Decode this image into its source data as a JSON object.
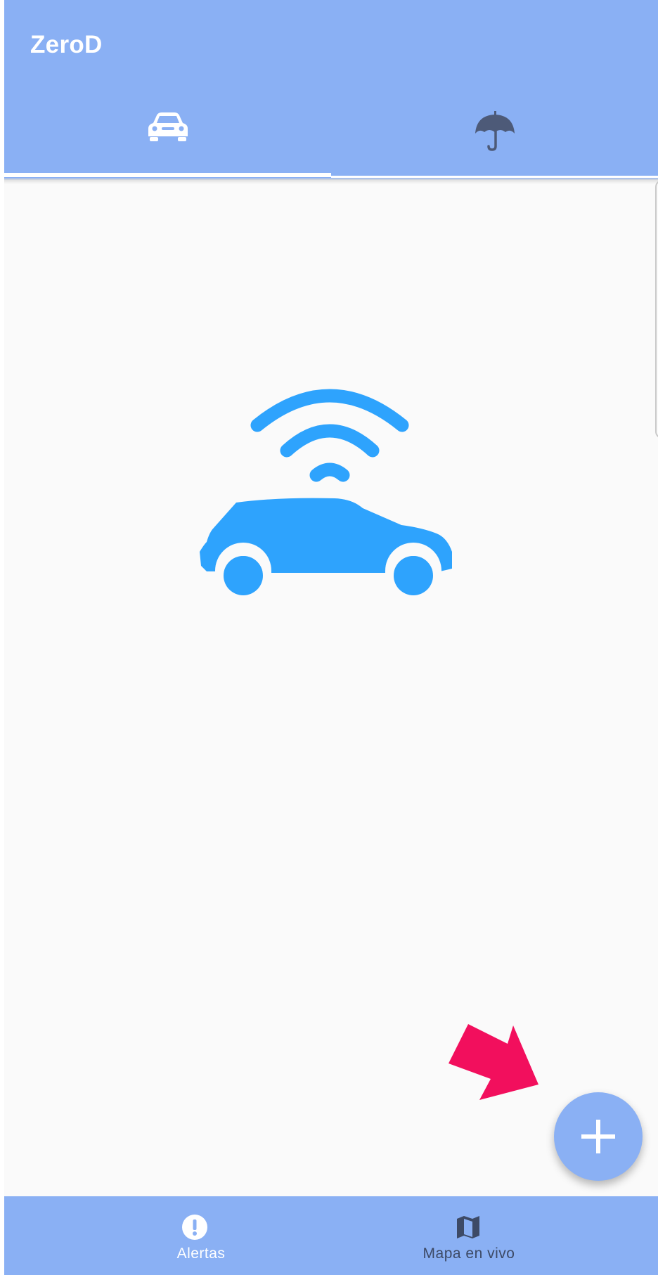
{
  "app": {
    "title": "ZeroD"
  },
  "tabs": [
    {
      "icon": "car-icon",
      "selected": true
    },
    {
      "icon": "umbrella-icon",
      "selected": false
    }
  ],
  "main": {
    "illustration": "connected-car-icon"
  },
  "fab": {
    "icon": "plus-icon",
    "hint_icon": "arrow-pointer-icon"
  },
  "bottom_nav": {
    "items": [
      {
        "label": "Alertas",
        "icon": "alert-icon",
        "selected": true
      },
      {
        "label": "Mapa en vivo",
        "icon": "map-icon",
        "selected": false
      }
    ]
  },
  "colors": {
    "primary": "#8ab0f4",
    "accent": "#2ea3fd",
    "hint_arrow": "#f20f5d",
    "inactive_icon": "#4d5a78",
    "background": "#fafafa"
  }
}
